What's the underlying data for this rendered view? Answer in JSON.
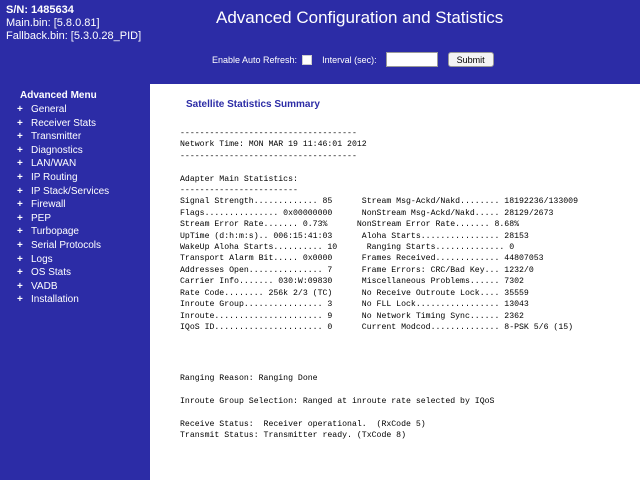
{
  "device": {
    "serial": "S/N: 1485634",
    "main_bin": "Main.bin: [5.8.0.81]",
    "fallback_bin": "Fallback.bin: [5.3.0.28_PID]"
  },
  "header": {
    "title": "Advanced Configuration and Statistics",
    "auto_refresh_label": "Enable Auto Refresh:",
    "interval_label": "Interval (sec):",
    "interval_value": "",
    "submit_label": "Submit"
  },
  "menu": {
    "title": "Advanced Menu",
    "items": [
      "General",
      "Receiver Stats",
      "Transmitter",
      "Diagnostics",
      "LAN/WAN",
      "IP Routing",
      "IP Stack/Services",
      "Firewall",
      "PEP",
      "Turbopage",
      "Serial Protocols",
      "Logs",
      "OS Stats",
      "VADB",
      "Installation"
    ]
  },
  "content": {
    "section_title": "Satellite Statistics Summary",
    "stats_text": "------------------------------------\nNetwork Time: MON MAR 19 11:46:01 2012\n------------------------------------\n\nAdapter Main Statistics:\n------------------------\nSignal Strength............. 85      Stream Msg-Ackd/Nakd........ 18192236/133009\nFlags............... 0x00000000      NonStream Msg-Ackd/Nakd..... 28129/2673\nStream Error Rate....... 0.73%      NonStream Error Rate....... 8.68%\nUpTime (d:h:m:s).. 006:15:41:03      Aloha Starts................ 28153\nWakeUp Aloha Starts.......... 10      Ranging Starts.............. 0\nTransport Alarm Bit..... 0x0000      Frames Received............. 44807053\nAddresses Open............... 7      Frame Errors: CRC/Bad Key... 1232/0\nCarrier Info....... 030:W:09830      Miscellaneous Problems...... 7302\nRate Code........ 256k 2/3 (TC)      No Receive Outroute Lock.... 35559\nInroute Group................ 3      No FLL Lock................. 13043\nInroute...................... 9      No Network Timing Sync...... 2362\nIQoS ID...................... 0      Current Modcod.............. 8-PSK 5/6 (15)",
    "status_text": "Ranging Reason: Ranging Done\n\nInroute Group Selection: Ranged at inroute rate selected by IQoS\n\nReceive Status:  Receiver operational.  (RxCode 5)\nTransmit Status: Transmitter ready. (TxCode 8)"
  }
}
